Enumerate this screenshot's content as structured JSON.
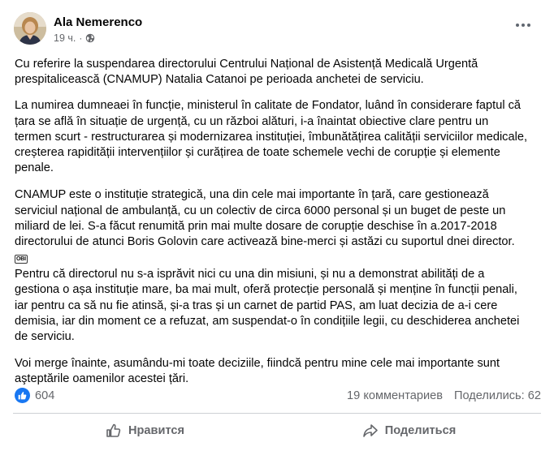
{
  "post": {
    "author": "Ala Nemerenco",
    "time": "19 ч.",
    "separator": "·",
    "audience_icon": "globe-icon",
    "paragraphs": [
      "Cu referire la suspendarea directorului Centrului Național de Asistență Medicală Urgentă\nprespitalicească (CNAMUP) Natalia Catanoi pe perioada anchetei de serviciu.",
      "La numirea dumneaei în funcție, ministerul în calitate de Fondator, luând în considerare faptul că\nțara se află în situație de urgență, cu un război alături, i-a înaintat obiective clare pentru un\ntermen scurt - restructurarea și modernizarea instituției, îmbunătățirea calității serviciilor medicale,\ncreșterea rapidității intervențiilor și curățirea de toate schemele vechi de corupție și elemente\npenale.",
      "CNAMUP este o instituție strategică, una din cele mai importante în țară, care gestionează\nserviciul național de ambulanță, cu un colectiv de circa 6000 personal și un buget de peste un\nmiliard de lei. S-a făcut renumită prin mai multe dosare de corupție deschise în a.2017-2018\ndirectorului de atunci Boris Golovin care activează bine-merci și astăzi cu suportul dnei director.",
      "Pentru că directorul nu s-a isprăvit nici cu una din misiuni, și nu a demonstrat abilități de a\ngestiona o așa instituție mare, ba mai mult, oferă protecție personală și menține în funcții penali,\niar pentru ca să nu fie atinsă, și-a tras și un carnet de partid PAS, am luat decizia de a-i cere\ndemisia, iar din moment ce a refuzat, am suspendat-o în condițiile legii, cu deschiderea anchetei\nde serviciu.",
      "Voi merge înainte, asumându-mi toate deciziile, fiindcă pentru mine cele mai importante sunt\naşteptările oamenilor acestei țări."
    ],
    "emoji_label": "ОВІ"
  },
  "stats": {
    "reactions": "604",
    "comments": "19 комментариев",
    "shares": "Поделились: 62"
  },
  "actions": {
    "like": "Нравится",
    "share": "Поделиться"
  },
  "colors": {
    "accent": "#1877f2",
    "secondary_text": "#65676b",
    "divider": "#ced0d4"
  }
}
